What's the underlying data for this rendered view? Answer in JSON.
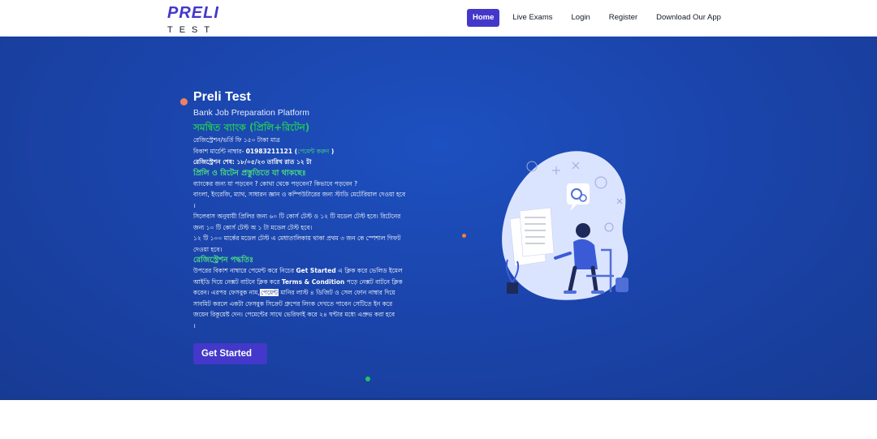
{
  "nav": {
    "logo_top": "PRELI",
    "logo_bottom": "TEST",
    "items": [
      {
        "label": "Home",
        "active": true
      },
      {
        "label": "Live Exams",
        "active": false
      },
      {
        "label": "Login",
        "active": false
      },
      {
        "label": "Register",
        "active": false
      },
      {
        "label": "Download Our App",
        "active": false
      }
    ]
  },
  "hero": {
    "title": "Preli Test",
    "subtitle": "Bank Job Preparation Platform",
    "headline": "সমন্বিত ব্যাংক (প্রিলি+রিটেন)",
    "fee_line": "রেজিস্ট্রেশন/ভর্তি ফি ১৫০ টাকা মাত্র",
    "bkash_prefix": "বিকাশ মার্চেন্ট নাম্বার- ",
    "bkash_number": "01983211121",
    "bkash_link_open": " (",
    "bkash_link": "পেমেন্ট করুন",
    "bkash_link_close": " )",
    "deadline": "রেজিস্ট্রেশন শেষ: ১৮/০৫/২৩ তারিখ রাত ১২ টা",
    "includes_head": "প্রিলি ও রিটেন প্রস্তুতিতে যা থাকছেঃ",
    "includes": [
      "ব্যাংকের জন্য যা পড়বেন ? কোথা থেকে পড়বেন? কিভাবে পড়বেন ?",
      "বাংলা, ইংরেজি, ম্যাথ, সাধারন জ্ঞান ও কম্পিউটারের জন্য স্টাডি মেটেরিয়াল দেওয়া হবে",
      "।",
      "সিলেবাস অনুযায়ী প্রিলির জন্য ৬০ টি কোর্স টেস্ট ও ১২ টি মডেল টেস্ট হবে। রিটেনের",
      "জন্য ১০ টি কোর্স টেস্ট অ ১ টা মডেল টেস্ট হবে।",
      "১২ টি ১০০ মার্কের মডেল টেস্ট এ মেধাতালিকায় থাকা প্রথম ৩ জন কে স্পেশাল গিফট",
      "দেওয়া হবে।"
    ],
    "process_head": "রেজিস্ট্রেশন পদ্ধতিঃ",
    "process": {
      "l1_a": "উপরের বিকাশ নাম্বারে পেমেন্ট করে নিচের ",
      "l1_b": "Get Started",
      "l1_c": " এ ক্লিক করে ভেলিড ইমেল",
      "l2_a": "আইডি দিয়ে নেক্সট বাটনে ক্লিক করে ",
      "l2_b": "Terms & Condition",
      "l2_c": " পড়ে নেক্সট বাটনে ক্লিক",
      "l3_a": "করেন। এরপর ফেসবুক নাম,",
      "l3_b": "পেমেন্ট",
      "l3_c": " মানির লাস্ট ৪ ডিজিট ও সেল ফোন নাম্বার দিয়ে",
      "l4": "সাবমিট করলে একটা ফেসবুক সিক্রেট গ্রুপের লিংক দেখতে পাবেন সেটিতে ইন করে",
      "l5": "জয়েন রিকুয়েষ্ট দেন। পেমেন্টের সাথে ভেরিফাই করে ২৪ ঘন্টার মধ্যে এপ্রুভ করা হবে",
      "l6": "।"
    },
    "cta_label": "Get Started"
  },
  "colors": {
    "brand": "#4338ca",
    "hero_bg": "#1b45ac",
    "accent_green": "#22c55e"
  }
}
